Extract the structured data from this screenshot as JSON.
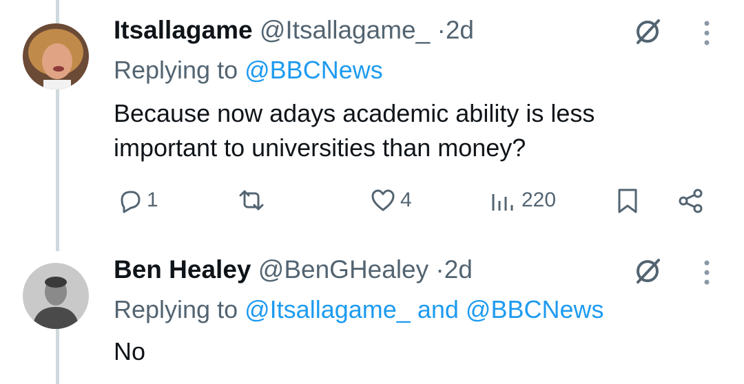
{
  "tweets": [
    {
      "name": "Itsallagame",
      "handle": "@Itsallagame_",
      "separator": "·",
      "time": "2d",
      "replying_prefix": "Replying to",
      "replying_to": "@BBCNews",
      "replying_join": "",
      "replying_to_2": "",
      "text_line1": "Because now adays academic ability is less",
      "text_line2": "important to universities than money?",
      "stats": {
        "replies": "1",
        "retweets": "",
        "likes": "4",
        "views": "220"
      }
    },
    {
      "name": "Ben Healey",
      "handle": "@BenGHealey",
      "separator": "·",
      "time": "2d",
      "replying_prefix": "Replying to",
      "replying_to": "@Itsallagame_",
      "replying_join": "and",
      "replying_to_2": "@BBCNews",
      "text_line1": "No"
    }
  ],
  "icons": [
    "grok-icon",
    "more-icon",
    "reply-icon",
    "retweet-icon",
    "like-icon",
    "views-icon",
    "bookmark-icon",
    "share-icon"
  ],
  "colors": {
    "link": "#1d9bf0",
    "secondary": "#536471",
    "text": "#0f1419",
    "thread_line": "#cfd9de"
  }
}
